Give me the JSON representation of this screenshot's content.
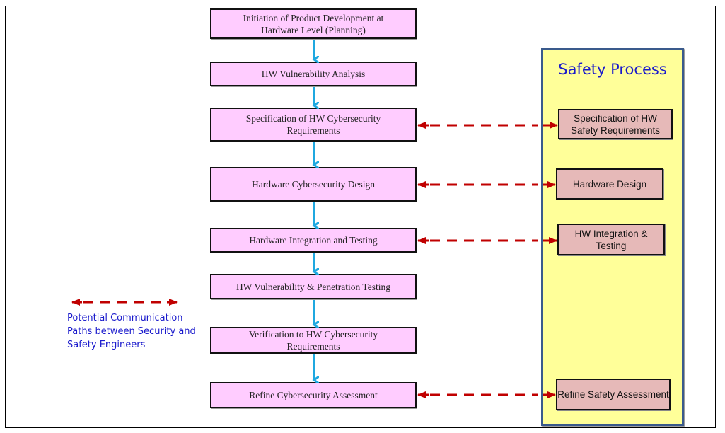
{
  "security_process": {
    "steps": [
      {
        "label": "Initiation of Product Development at Hardware Level (Planning)"
      },
      {
        "label": "HW Vulnerability Analysis"
      },
      {
        "label": "Specification of HW Cybersecurity Requirements"
      },
      {
        "label": "Hardware Cybersecurity Design"
      },
      {
        "label": "Hardware Integration and Testing"
      },
      {
        "label": "HW Vulnerability & Penetration Testing"
      },
      {
        "label": "Verification to HW Cybersecurity Requirements"
      },
      {
        "label": "Refine Cybersecurity Assessment"
      }
    ]
  },
  "safety_process": {
    "title": "Safety Process",
    "steps": [
      {
        "label": "Specification of HW Safety Requirements",
        "links_to_security_step": 3
      },
      {
        "label": "Hardware Design",
        "links_to_security_step": 4
      },
      {
        "label": "HW Integration & Testing",
        "links_to_security_step": 5
      },
      {
        "label": "Refine Safety Assessment",
        "links_to_security_step": 8
      }
    ]
  },
  "legend": {
    "text": "Potential Communication Paths between Security and Safety Engineers",
    "line1": "Potential Communication",
    "line2": "Paths between Security and",
    "line3": "Safety Engineers"
  },
  "colors": {
    "security_box_fill": "#ffccff",
    "safety_box_fill": "#e6b9b8",
    "safety_panel_fill": "#ffff99",
    "safety_panel_border": "#3a5a8c",
    "flow_arrow": "#1fa8e0",
    "communication_arrow": "#c00000",
    "title_text": "#1a1acc"
  }
}
